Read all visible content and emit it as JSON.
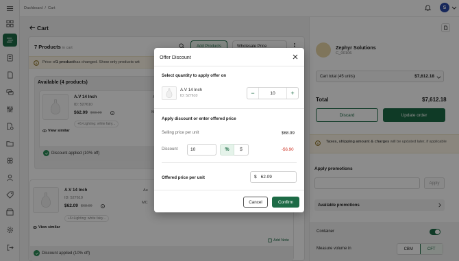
{
  "topbar": {
    "breadcrumb": [
      "Dashboard",
      "Cart"
    ],
    "breadcrumb_sep": "/",
    "user_initial": "S"
  },
  "main": {
    "title": "Cart",
    "products_count": "7 Products",
    "in_cart": "in cart",
    "add_products": "Add Products",
    "price_type": "Wholesale Price",
    "notice_pre": "Price of ",
    "notice_bold": "1 product",
    "notice_post": " has changed.  Show only products wit",
    "available_title": "Available (4 products)",
    "products": [
      {
        "name": "A.V 14 Inch",
        "id": "ID: 527610",
        "price": "$62.09",
        "old_price": "$68.99",
        "tags": "+6>Lighting: white fairy...",
        "view_similar": "View similar",
        "au": "Au",
        "mc": "MC",
        "discount": "Discount applied (10% off)"
      },
      {
        "name": "A.V 14 Inch",
        "id": "ID: 527610",
        "price": "$62.09",
        "old_price": "$68.99",
        "tags": "+6>Lighting: white fairy...",
        "view_similar": "View similar",
        "au": "Au",
        "mc": "MC",
        "discount": "Discount applied (10% off)"
      }
    ],
    "add_note": "Add Note"
  },
  "right": {
    "customer_name": "Zephyr Solutions",
    "customer_code": "C_00106",
    "cart_total_label": "Cart total (45 units)",
    "cart_total_value": "$7,612.18",
    "total_label": "Total",
    "total_value": "$7,612.18",
    "discard": "Discard",
    "update_order": "Update order",
    "tax_note_bold": "Taxes, shipping amount & charges",
    "tax_note_rest": " will be updated later, if applicable",
    "apply_promotions": "Apply promotions",
    "apply": "Apply",
    "available_promotions": "Available promotions",
    "container": "Container",
    "container_on": true,
    "measure_volume": "Measure volume in",
    "units": [
      "CBM",
      "CFT"
    ],
    "selected_unit": "CFT"
  },
  "modal": {
    "title": "Offer Discount",
    "section_qty": "Select quantity to apply offer on",
    "product_name": "A.V 14 Inch",
    "product_id": "ID: 527610",
    "qty_minus": "−",
    "qty_plus": "+",
    "quantity": "10",
    "section_discount": "Apply discount or enter offered price",
    "selling_price_label": "Selling price per unit",
    "selling_price_value": "$68.99",
    "discount_label": "Discount",
    "discount_input": "10",
    "percent_symbol": "%",
    "dollar_symbol": "$",
    "discount_value": "-$6.90",
    "offered_label": "Offered price per unit",
    "offered_currency": "$",
    "offered_value": "62.09",
    "cancel": "Cancel",
    "confirm": "Confirm"
  },
  "colors": {
    "brand": "#1d6b46",
    "discount_red": "#d0392b",
    "notice_bg": "#fbf5e6",
    "avatar_blue": "#2b4aa6"
  },
  "icons": [
    "hamburger-icon",
    "dashboard-icon",
    "cart-icon",
    "orders-icon",
    "chat-icon",
    "filters-icon",
    "file-icon",
    "folder-icon",
    "grid-icon",
    "user-icon",
    "tag-icon",
    "store-icon",
    "settings-icon",
    "logout-icon",
    "bell-icon",
    "search-icon",
    "document-icon"
  ]
}
